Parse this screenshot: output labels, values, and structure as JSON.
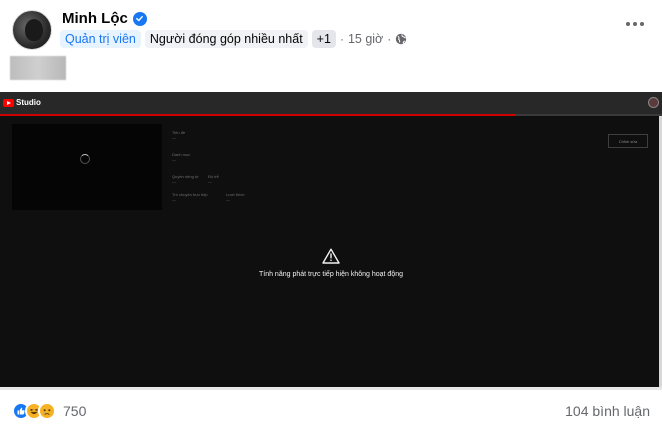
{
  "post": {
    "author_name": "Minh Lộc",
    "badges": {
      "admin": "Quản trị viên",
      "top_contributor": "Người đóng góp nhiều nhất",
      "more": "+1"
    },
    "separator": "·",
    "time": "15 giờ",
    "icons": {
      "verified": "verified-check-icon",
      "privacy": "globe-icon",
      "menu": "more-horizontal-icon"
    }
  },
  "screenshot": {
    "brand": "Studio",
    "edit_button": "Chỉnh sửa",
    "warning_text": "Tính năng phát trực tiếp hiện không hoạt động",
    "progress_fraction": 0.78,
    "info_rows": [
      {
        "label": "Tiêu đề",
        "value": "—"
      },
      {
        "label": "Danh mục",
        "value": "—"
      },
      {
        "label": "Quyền riêng tư",
        "value": "—"
      },
      {
        "label": "Độ trễ",
        "value": "—"
      },
      {
        "label": "Trò chuyện trực tiếp",
        "value": "—"
      },
      {
        "label": "Lượt thích",
        "value": "—"
      }
    ],
    "colors": {
      "youtube_red": "#ff0000",
      "progress": "#cc0000",
      "background": "#0f0f0f"
    }
  },
  "footer": {
    "reaction_count": "750",
    "comments": "104 bình luận",
    "reactions": [
      "like-icon",
      "haha-icon",
      "sad-icon"
    ]
  }
}
